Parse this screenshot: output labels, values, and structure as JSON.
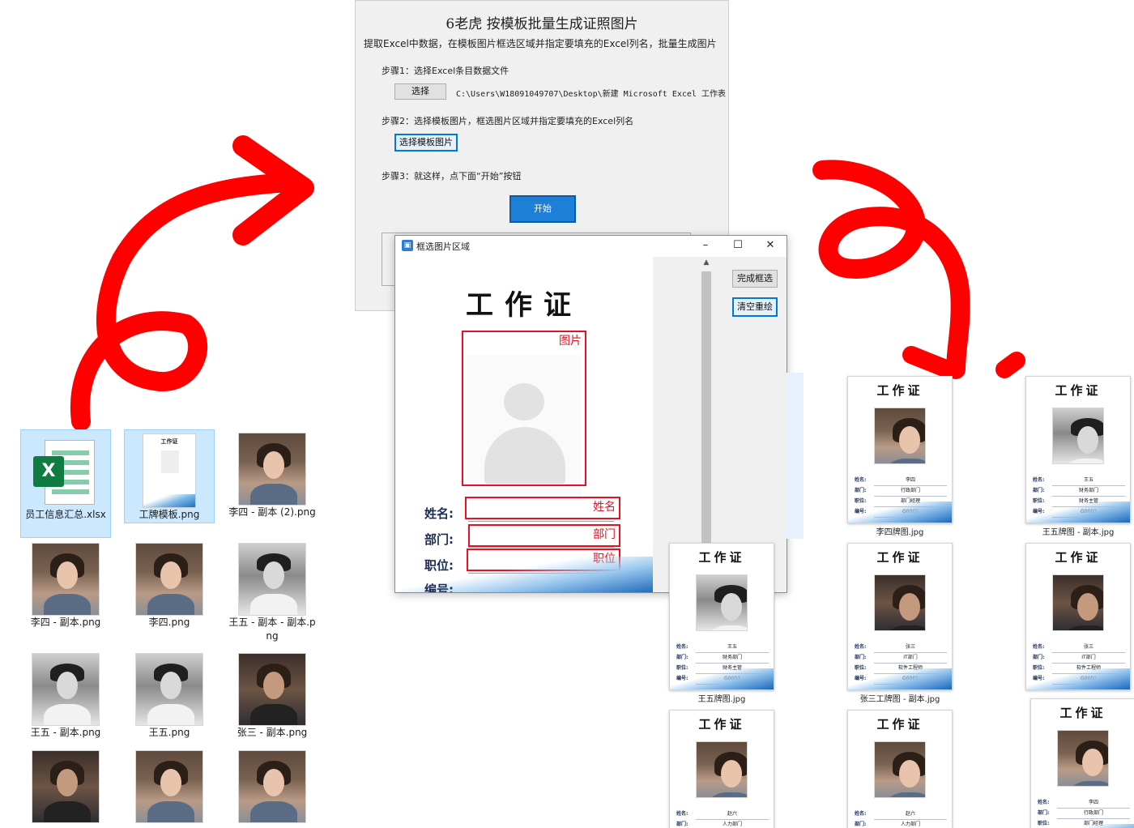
{
  "main_window": {
    "title": "6老虎 按模板批量生成证照图片",
    "description": "提取Excel中数据，在模板图片框选区域并指定要填充的Excel列名，批量生成图片",
    "step1_text": "步骤1：选择Excel条目数据文件",
    "select_button": "选择",
    "file_path": "C:\\Users\\W18091049707\\Desktop\\新建 Microsoft Excel 工作表.xlsx",
    "step2_text": "步骤2：选择模板图片，框选图片区域并指定要填充的Excel列名",
    "select_template_button": "选择模板图片",
    "step3_text": "步骤3：就这样，点下面“开始”按钮",
    "start_button": "开始"
  },
  "dialog": {
    "title": "框选图片区域",
    "finish_button": "完成框选",
    "clear_button": "清空重绘",
    "card_title": "工作证",
    "field_labels": {
      "name": "姓名:",
      "dept": "部门:",
      "position": "职位:",
      "number": "编号:"
    },
    "regions": {
      "photo": "图片",
      "name": "姓名",
      "dept": "部门",
      "position": "职位"
    }
  },
  "explorer": {
    "files": [
      {
        "name": "员工信息汇总.xlsx",
        "kind": "xlsx"
      },
      {
        "name": "工牌模板.png",
        "kind": "template"
      },
      {
        "name": "李四 - 副本 (2).png",
        "kind": "girl"
      },
      {
        "name": "李四 - 副本.png",
        "kind": "girl"
      },
      {
        "name": "李四.png",
        "kind": "girl"
      },
      {
        "name": "王五 - 副本 - 副本.png",
        "kind": "boy"
      },
      {
        "name": "王五 - 副本.png",
        "kind": "boy"
      },
      {
        "name": "王五.png",
        "kind": "boy"
      },
      {
        "name": "张三 - 副本.png",
        "kind": "zhang"
      }
    ]
  },
  "results": {
    "cards": [
      {
        "caption": "李四牌图.jpg",
        "name": "李四",
        "dept": "行政部门",
        "position": "部门经理",
        "number": "G0002",
        "photo": "girl"
      },
      {
        "caption": "王五牌图 - 副本.jpg",
        "name": "王五",
        "dept": "财务部门",
        "position": "财务主管",
        "number": "G0003",
        "photo": "boy"
      },
      {
        "caption": "王五牌图.jpg",
        "name": "王五",
        "dept": "财务部门",
        "position": "财务主管",
        "number": "G0003",
        "photo": "boy"
      },
      {
        "caption": "张三工牌图 - 副本.jpg",
        "name": "张三",
        "dept": "IT部门",
        "position": "软件工程师",
        "number": "G0001",
        "photo": "zhang"
      },
      {
        "caption": "",
        "name": "张三",
        "dept": "IT部门",
        "position": "软件工程师",
        "number": "G0001",
        "photo": "zhang"
      },
      {
        "caption": "",
        "name": "赵六",
        "dept": "人力部门",
        "position": "",
        "number": "",
        "photo": "girl"
      },
      {
        "caption": "",
        "name": "赵六",
        "dept": "人力部门",
        "position": "",
        "number": "",
        "photo": "girl"
      },
      {
        "caption": "",
        "name": "李四",
        "dept": "行政部门",
        "position": "部门经理",
        "number": "",
        "photo": "girl"
      }
    ]
  },
  "colors": {
    "selection_red": "#e81123",
    "arrow_red": "#ff0000",
    "accent_blue": "#0078d7"
  }
}
